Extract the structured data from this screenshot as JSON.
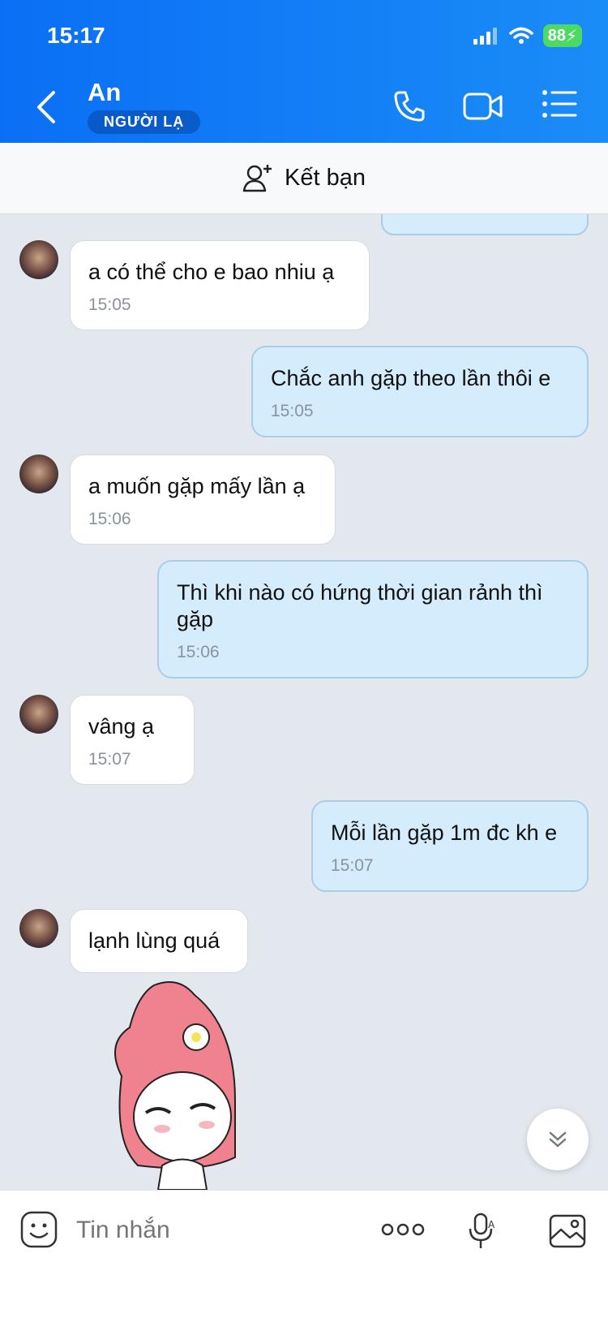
{
  "status_bar": {
    "time": "15:17",
    "battery": "88"
  },
  "header": {
    "contact_name": "An",
    "badge": "NGƯỜI LẠ"
  },
  "add_friend": {
    "label": "Kết bạn"
  },
  "messages": [
    {
      "dir": "in",
      "text": "a có thể cho e bao nhiu ạ",
      "time": "15:05"
    },
    {
      "dir": "out",
      "text": "Chắc anh gặp theo lần thôi e",
      "time": "15:05"
    },
    {
      "dir": "in",
      "text": "a muốn gặp mấy lần ạ",
      "time": "15:06"
    },
    {
      "dir": "out",
      "text": "Thì khi nào có hứng thời gian rảnh thì gặp",
      "time": "15:06"
    },
    {
      "dir": "in",
      "text": "vâng ạ",
      "time": "15:07"
    },
    {
      "dir": "out",
      "text": "Mỗi lần gặp 1m đc kh e",
      "time": "15:07"
    },
    {
      "dir": "in",
      "text": "lạnh lùng quá",
      "time": ""
    }
  ],
  "input": {
    "placeholder": "Tin nhắn"
  },
  "icons": {
    "back": "chevron-left-icon",
    "call": "phone-icon",
    "video": "video-camera-icon",
    "menu": "list-icon",
    "add_friend": "add-user-icon",
    "emoji": "emoji-icon",
    "more": "more-dots-icon",
    "mic": "microphone-icon",
    "image": "image-icon",
    "scroll": "chevron-double-down-icon"
  },
  "colors": {
    "header": "#0b6ff5",
    "outgoing_bubble": "#d4ecfb",
    "incoming_bubble": "#ffffff",
    "background": "#e3e8ef"
  }
}
